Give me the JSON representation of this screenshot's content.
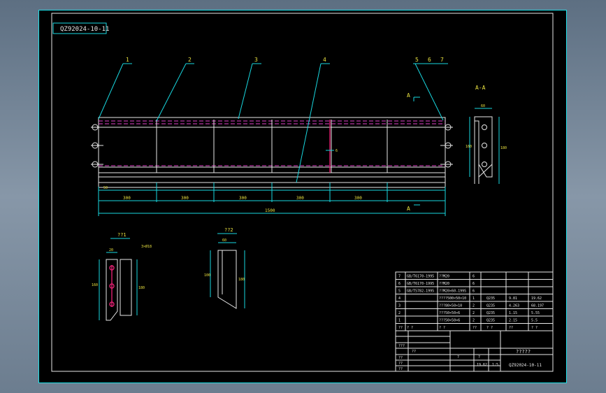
{
  "title_stamp": "QZ92024-10-11",
  "balloons": [
    "1",
    "2",
    "3",
    "4",
    "5",
    "6",
    "7"
  ],
  "section_marks": {
    "view_label": "A-A",
    "cut_letter_top": "A",
    "cut_letter_bottom": "A"
  },
  "main_view_dims": {
    "segments": [
      "300",
      "300",
      "300",
      "300",
      "300"
    ],
    "overall": "1500",
    "left_small": "50",
    "mid_small": "6"
  },
  "section_view_dims": {
    "top": "60",
    "left": "160",
    "right": "180"
  },
  "detail_1": {
    "title": "??1",
    "note": "3×Ø18",
    "dim_left": "160",
    "dim_right": "180",
    "dim_top": "20"
  },
  "detail_2": {
    "title": "??2",
    "dim_left": "100",
    "dim_right": "180",
    "dim_top": "60"
  },
  "bom": {
    "rows": [
      {
        "no": "7",
        "code": "GB/T6170-1995",
        "name": "??M20",
        "qty": "6",
        "mat": "",
        "w1": "",
        "w2": ""
      },
      {
        "no": "6",
        "code": "GB/T6170-1995",
        "name": "??M20",
        "qty": "6",
        "mat": "",
        "w1": "",
        "w2": ""
      },
      {
        "no": "5",
        "code": "GB/T5782-1995",
        "name": "??M20×60-1995",
        "qty": "6",
        "mat": "",
        "w1": "",
        "w2": ""
      },
      {
        "no": "4",
        "code": "",
        "name": "????500×50×10",
        "qty": "1",
        "mat": "Q235",
        "w1": "9.81",
        "w2": "19.62"
      },
      {
        "no": "3",
        "code": "",
        "name": "???80×50×10",
        "qty": "2",
        "mat": "Q235",
        "w1": "4.263",
        "w2": "68.197"
      },
      {
        "no": "2",
        "code": "",
        "name": "???50×50×6",
        "qty": "2",
        "mat": "Q235",
        "w1": "1.15",
        "w2": "5.55"
      },
      {
        "no": "1",
        "code": "",
        "name": "???50×50×6",
        "qty": "2",
        "mat": "Q235",
        "w1": "2.15",
        "w2": "5.5"
      }
    ],
    "header": {
      "no": "??",
      "code": "? ?",
      "name": "? ?",
      "qty": "??",
      "mat": "? ?",
      "w1": "??",
      "w2": "? ?"
    }
  },
  "title_block": {
    "part_name": "?????",
    "drawing_no": "QZ92024-10-11",
    "scale": "1:5",
    "weight": "19.62",
    "cells": [
      "???",
      "??",
      "??",
      "??",
      "??",
      "?",
      "?"
    ]
  }
}
